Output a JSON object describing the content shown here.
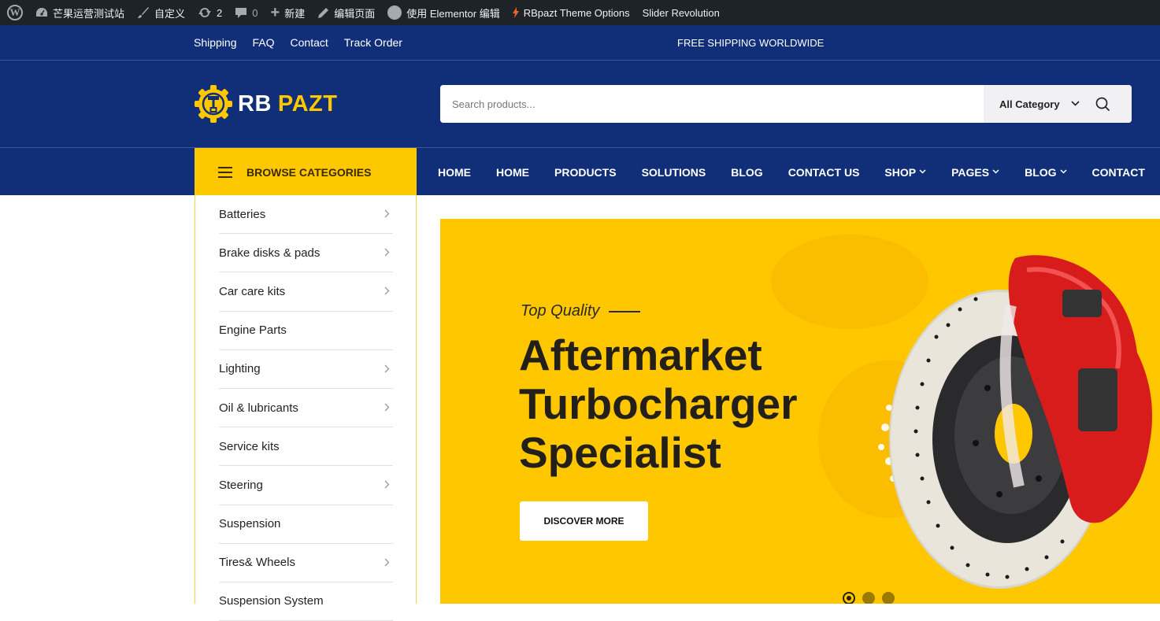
{
  "admin_bar": {
    "site_name": "芒果运营测试站",
    "customize": "自定义",
    "updates_count": "2",
    "comments_count": "0",
    "new_label": "新建",
    "edit_page": "编辑页面",
    "elementor_edit": "使用 Elementor 编辑",
    "theme_options": "RBpazt Theme Options",
    "slider_revolution": "Slider Revolution"
  },
  "topbar": {
    "links": [
      "Shipping",
      "FAQ",
      "Contact",
      "Track Order"
    ],
    "promo": "FREE SHIPPING WORLDWIDE"
  },
  "header": {
    "logo_part1": "RB",
    "logo_part2": "PAZT",
    "search_placeholder": "Search products...",
    "category_select": "All Category"
  },
  "nav": {
    "browse_label": "BROWSE CATEGORIES",
    "items": [
      {
        "label": "HOME",
        "dropdown": false
      },
      {
        "label": "HOME",
        "dropdown": false
      },
      {
        "label": "PRODUCTS",
        "dropdown": false
      },
      {
        "label": "SOLUTIONS",
        "dropdown": false
      },
      {
        "label": "BLOG",
        "dropdown": false
      },
      {
        "label": "CONTACT US",
        "dropdown": false
      },
      {
        "label": "SHOP",
        "dropdown": true
      },
      {
        "label": "PAGES",
        "dropdown": true
      },
      {
        "label": "BLOG",
        "dropdown": true
      },
      {
        "label": "CONTACT",
        "dropdown": false
      }
    ]
  },
  "categories": [
    {
      "label": "Batteries",
      "has_sub": true
    },
    {
      "label": "Brake disks & pads",
      "has_sub": true
    },
    {
      "label": "Car care kits",
      "has_sub": true
    },
    {
      "label": "Engine Parts",
      "has_sub": false
    },
    {
      "label": "Lighting",
      "has_sub": true
    },
    {
      "label": "Oil & lubricants",
      "has_sub": true
    },
    {
      "label": "Service kits",
      "has_sub": false
    },
    {
      "label": "Steering",
      "has_sub": true
    },
    {
      "label": "Suspension",
      "has_sub": false
    },
    {
      "label": "Tires& Wheels",
      "has_sub": true
    },
    {
      "label": "Suspension System",
      "has_sub": false
    }
  ],
  "hero": {
    "tagline": "Top Quality",
    "headline_lines": [
      "Aftermarket",
      "Turbocharger",
      "Specialist"
    ],
    "cta": "DISCOVER MORE",
    "slides_total": 3,
    "active_slide": 1
  },
  "colors": {
    "brand_blue": "#112f78",
    "brand_yellow": "#fdc800",
    "admin_bar": "#1d2327"
  }
}
